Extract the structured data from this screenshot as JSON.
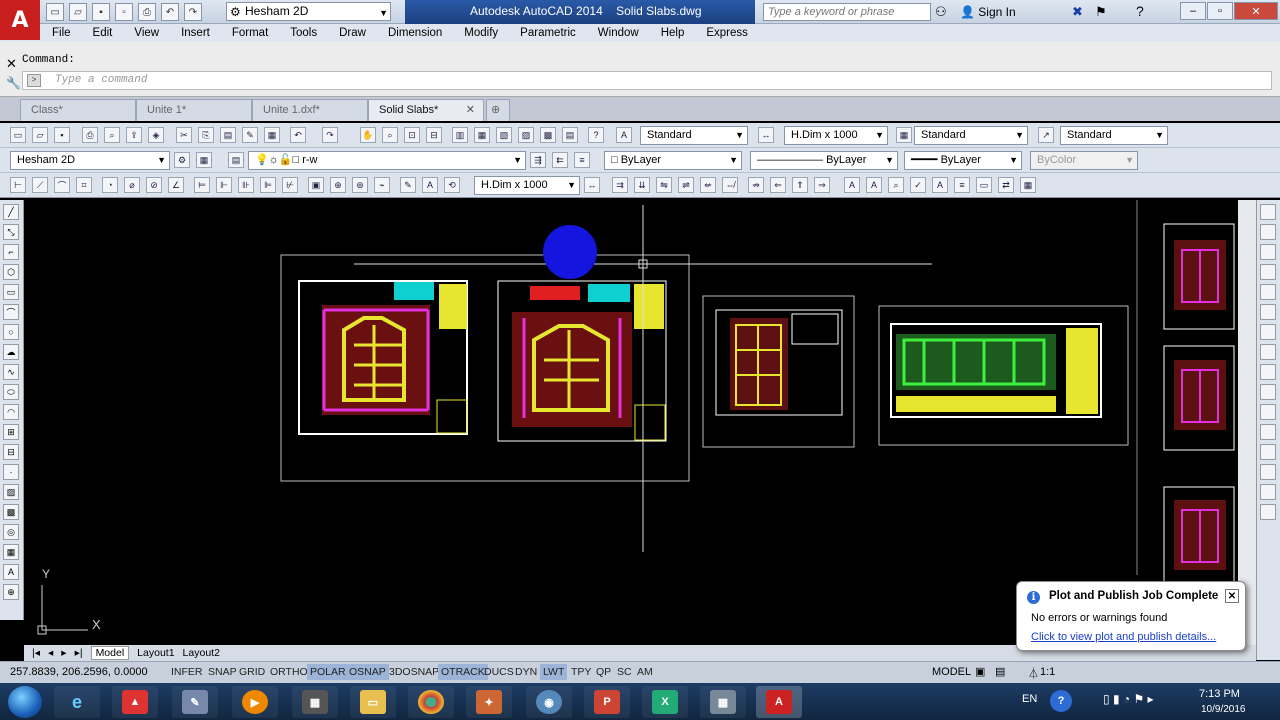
{
  "window": {
    "workspace": "Hesham 2D",
    "app_title": "Autodesk AutoCAD 2014",
    "file_title": "Solid Slabs.dwg",
    "search_placeholder": "Type a keyword or phrase",
    "signin": "Sign In"
  },
  "menu": [
    "File",
    "Edit",
    "View",
    "Insert",
    "Format",
    "Tools",
    "Draw",
    "Dimension",
    "Modify",
    "Parametric",
    "Window",
    "Help",
    "Express"
  ],
  "command": {
    "label": "Command:",
    "placeholder": "Type a command"
  },
  "file_tabs": [
    "Class*",
    "Unite 1*",
    "Unite 1.dxf*",
    "Solid Slabs*"
  ],
  "toolbar": {
    "text_style": "Standard",
    "dim_style": "H.Dim x 1000",
    "table_style": "Standard",
    "mleader_style": "Standard",
    "workspace2": "Hesham 2D",
    "layer": "r-w",
    "color": "ByLayer",
    "linetype": "ByLayer",
    "lineweight": "ByLayer",
    "plotstyle": "ByColor",
    "dim_style2": "H.Dim x 1000"
  },
  "ucs": {
    "y": "Y",
    "x": "X"
  },
  "layout_tabs": [
    "Model",
    "Layout1",
    "Layout2"
  ],
  "status": {
    "coords": "257.8839, 206.2596, 0.0000",
    "toggles": [
      "INFER",
      "SNAP",
      "GRID",
      "ORTHO",
      "POLAR",
      "OSNAP",
      "3DOSNAP",
      "OTRACK",
      "DUCS",
      "DYN",
      "LWT",
      "TPY",
      "QP",
      "SC",
      "AM"
    ],
    "active_toggles": [
      "POLAR",
      "OSNAP",
      "OTRACK",
      "LWT"
    ],
    "model": "MODEL",
    "scale": "1:1"
  },
  "balloon": {
    "title": "Plot and Publish Job Complete",
    "message": "No errors or warnings found",
    "link": "Click to view plot and publish details..."
  },
  "taskbar": {
    "lang": "EN",
    "time": "7:13 PM",
    "date": "10/9/2016"
  }
}
